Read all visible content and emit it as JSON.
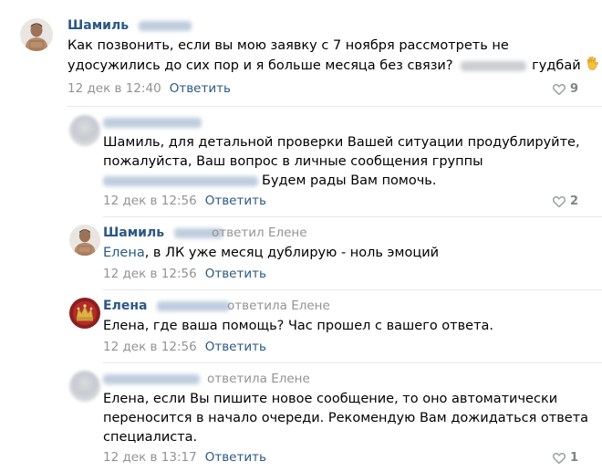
{
  "comments": [
    {
      "author": "Шамиль",
      "text_line1": "Как позвонить, если вы мою заявку с 7 ноября рассмотреть не",
      "text_line2_pre": "удосужились до сих пор и я больше месяца без связи?",
      "text_line2_post": "гудбай",
      "date": "12 дек в 12:40",
      "reply_label": "Ответить",
      "likes": "9"
    },
    {
      "text_line1": "Шамиль, для детальной проверки Вашей ситуации продублируйте,",
      "text_line2": "пожалуйста, Ваш вопрос в личные сообщения группы",
      "text_line3": "Будем рады Вам помочь.",
      "date": "12 дек в 12:56",
      "reply_label": "Ответить",
      "likes": "2"
    },
    {
      "author": "Шамиль",
      "replied_to": "ответил Елене",
      "mention": "Елена",
      "text": ", в ЛК уже месяц дублирую - ноль эмоций",
      "date": "12 дек в 12:56",
      "reply_label": "Ответить"
    },
    {
      "author": "Елена",
      "replied_to": "ответила Елене",
      "text": "Елена, где ваша помощь? Час прошел с вашего ответа.",
      "date": "12 дек в 12:56",
      "reply_label": "Ответить"
    },
    {
      "replied_to": "ответила Елене",
      "text_line1": "Елена, если Вы пишите новое сообщение, то оно автоматически",
      "text_line2": "переносится в начало очереди. Рекомендую Вам дожидаться ответа",
      "text_line3": "специалиста.",
      "date": "12 дек в 13:17",
      "reply_label": "Ответить",
      "likes": "1"
    }
  ],
  "colors": {
    "link": "#2a5885",
    "meta": "#939393",
    "likes": "#828282",
    "separator": "#e7e8ec"
  },
  "icons": [
    "heart-icon",
    "waving-hand-emoji"
  ]
}
